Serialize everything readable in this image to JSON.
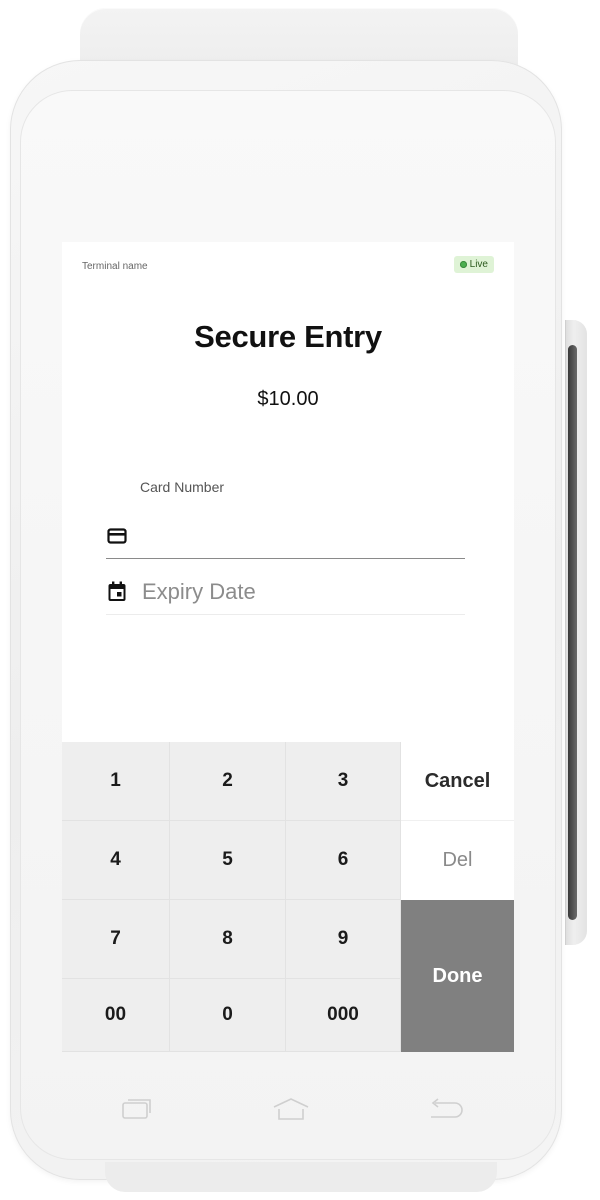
{
  "header": {
    "terminal_name": "Terminal name",
    "status_badge": "Live"
  },
  "main": {
    "title": "Secure Entry",
    "amount": "$10.00",
    "card_number": {
      "label": "Card Number",
      "value": "",
      "placeholder": "",
      "icon": "credit-card-icon"
    },
    "expiry_date": {
      "value": "",
      "placeholder": "Expiry Date",
      "icon": "calendar-icon"
    }
  },
  "keypad": {
    "keys": [
      "1",
      "2",
      "3",
      "4",
      "5",
      "6",
      "7",
      "8",
      "9",
      "00",
      "0",
      "000"
    ],
    "cancel_label": "Cancel",
    "delete_label": "Del",
    "done_label": "Done"
  },
  "nav_bar": {
    "icons": [
      "recent-apps-icon",
      "home-icon",
      "back-icon"
    ]
  },
  "colors": {
    "live_badge_bg": "#dff3d6",
    "live_dot": "#4caf50",
    "keypad_bg": "#eeeeee",
    "done_button_bg": "#808080"
  }
}
